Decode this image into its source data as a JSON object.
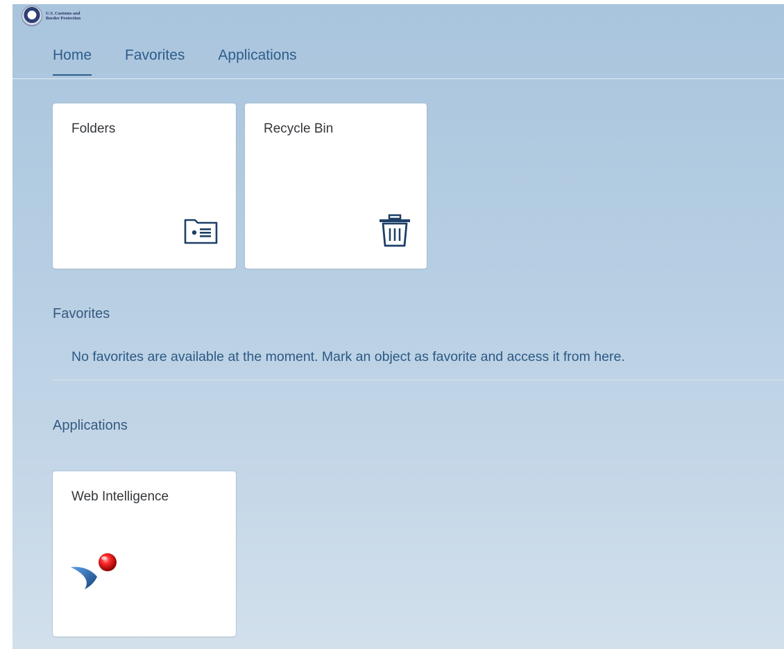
{
  "header": {
    "agency_line1": "U.S. Customs and",
    "agency_line2": "Border Protection",
    "logo_icon": "cbp-seal-icon"
  },
  "tabs": [
    {
      "label": "Home",
      "active": true
    },
    {
      "label": "Favorites",
      "active": false
    },
    {
      "label": "Applications",
      "active": false
    }
  ],
  "tiles": {
    "folders": {
      "label": "Folders",
      "icon": "folder-icon"
    },
    "recycle_bin": {
      "label": "Recycle Bin",
      "icon": "trash-icon"
    }
  },
  "favorites": {
    "title": "Favorites",
    "empty_message": "No favorites are available at the moment. Mark an object as favorite and access it from here."
  },
  "applications": {
    "title": "Applications",
    "tiles": [
      {
        "label": "Web Intelligence",
        "icon": "web-intelligence-icon"
      }
    ]
  },
  "colors": {
    "accent": "#2e5d8b",
    "icon": "#1d3f66"
  }
}
